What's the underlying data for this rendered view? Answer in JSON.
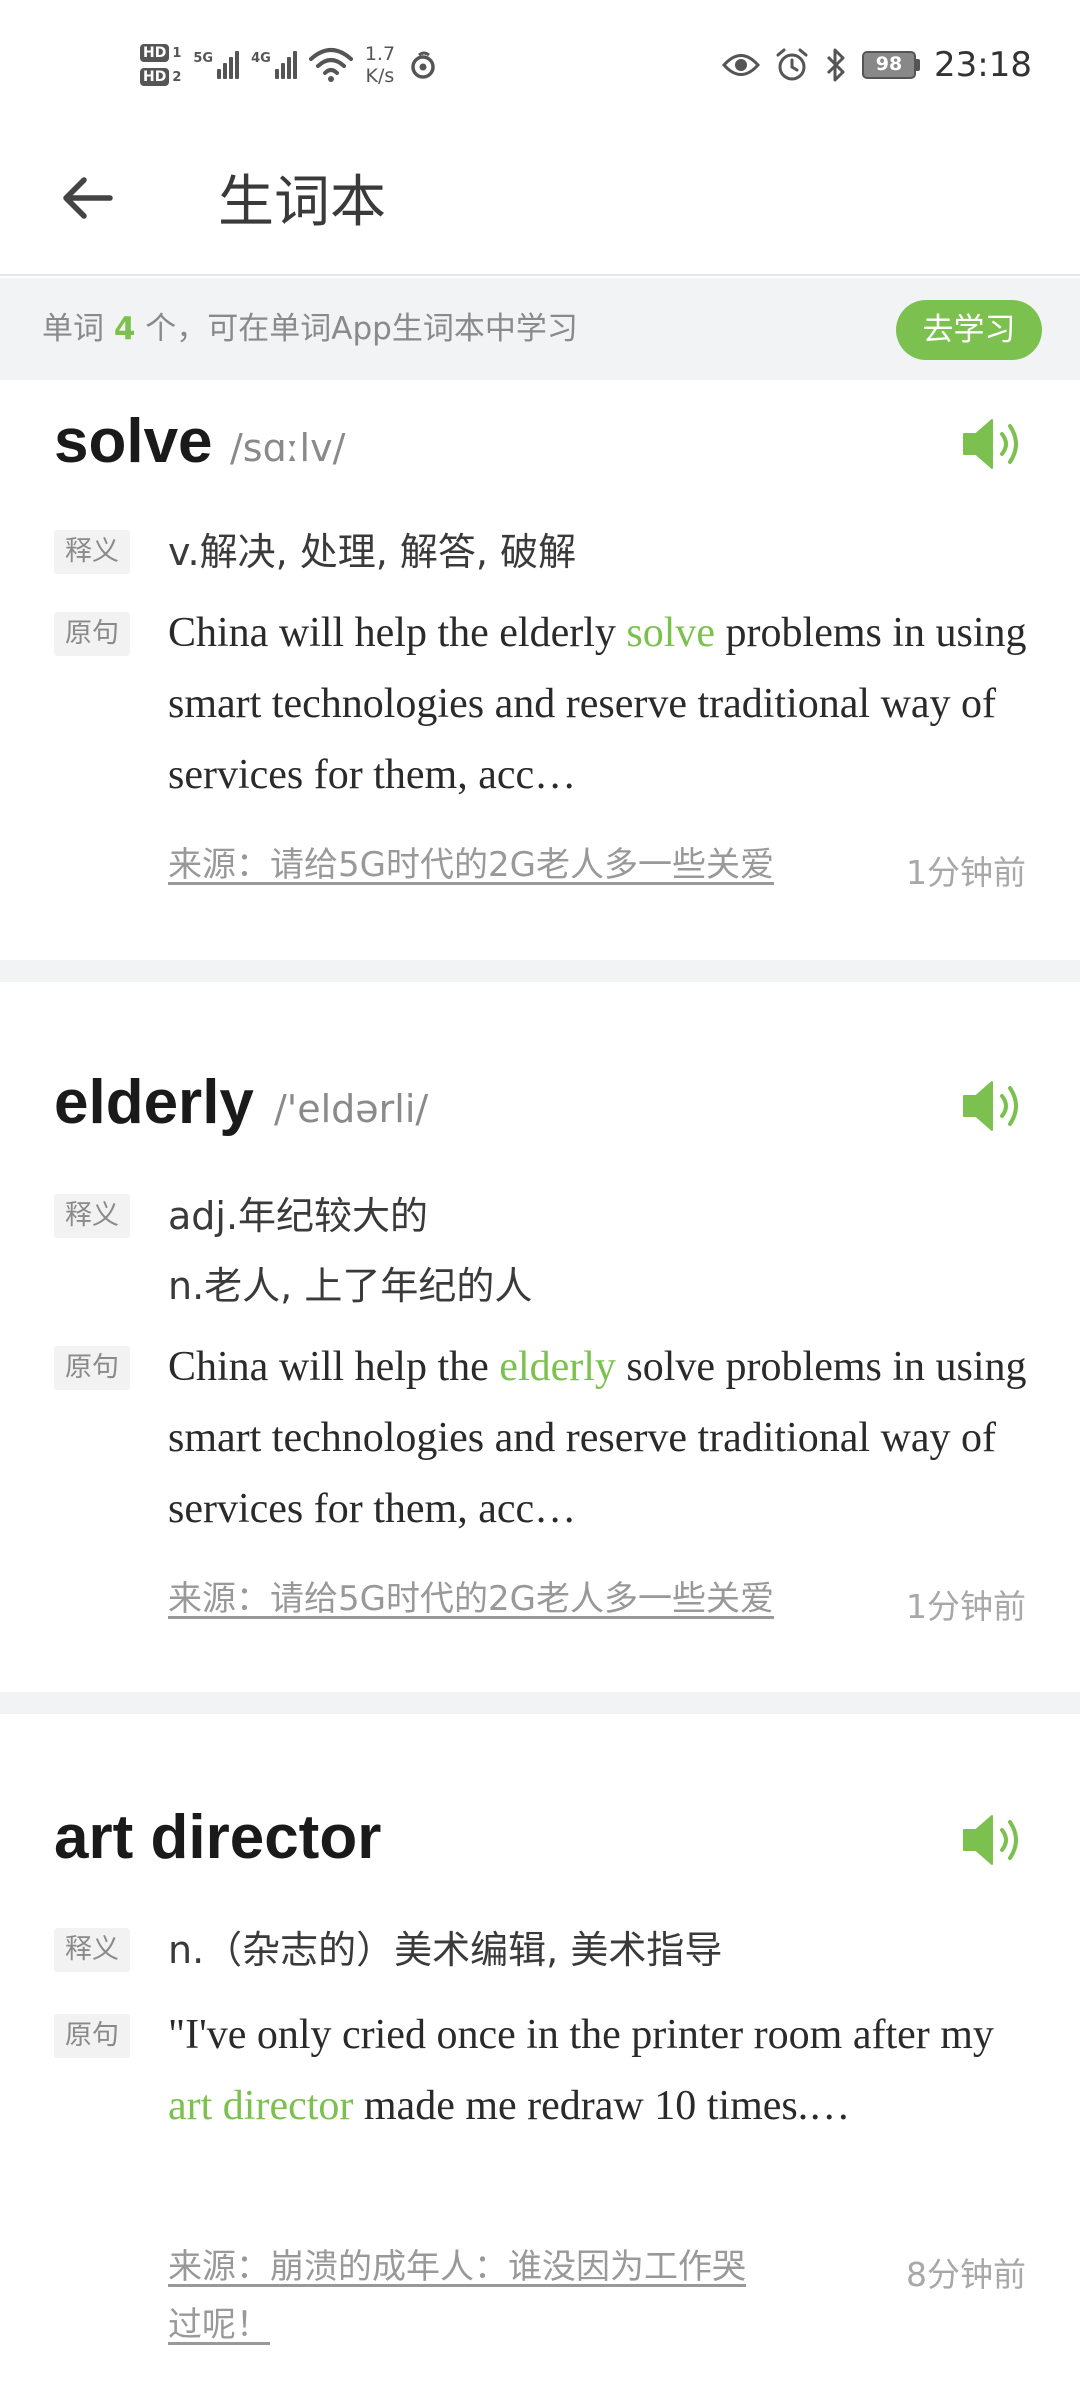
{
  "status_bar": {
    "hd1": "HD",
    "hd1_num": "1",
    "hd2": "HD",
    "hd2_num": "2",
    "sig1_label": "5G",
    "sig2_label": "4G",
    "speed_value": "1.7",
    "speed_unit": "K/s",
    "battery": "98",
    "time": "23:18",
    "icons": [
      "wifi-icon",
      "app-notification-icon",
      "eye-icon",
      "alarm-icon",
      "bluetooth-icon"
    ]
  },
  "app_bar": {
    "back_icon": "arrow-left-icon",
    "title": "生词本"
  },
  "info_strip": {
    "prefix": "单词 ",
    "count": "4",
    "suffix": " 个，可在单词App生词本中学习",
    "button_label": "去学习"
  },
  "colors": {
    "accent": "#7cc14f",
    "strip_bg": "#f2f3f5"
  },
  "words": [
    {
      "word": "solve",
      "phonetic": "/sɑːlv/",
      "tag_meaning": "释义",
      "meanings": [
        "v.解决, 处理, 解答, 破解"
      ],
      "tag_sentence": "原句",
      "sentence_before": "China will help the elderly ",
      "sentence_highlight": "solve",
      "sentence_after": " problems in using smart technologies and reserve traditional way of services for them, acc…",
      "source": "来源：请给5G时代的2G老人多一些关爱",
      "time": "1分钟前"
    },
    {
      "word": "elderly",
      "phonetic": "/'eldərli/",
      "tag_meaning": "释义",
      "meanings": [
        "adj.年纪较大的",
        "n.老人, 上了年纪的人"
      ],
      "tag_sentence": "原句",
      "sentence_before": "China will help the ",
      "sentence_highlight": "elderly",
      "sentence_after": " solve problems in using smart technologies and reserve traditional way of services for them, acc…",
      "source": "来源：请给5G时代的2G老人多一些关爱",
      "time": "1分钟前"
    },
    {
      "word": "art director",
      "phonetic": "",
      "tag_meaning": "释义",
      "meanings": [
        "n.（杂志的）美术编辑, 美术指导"
      ],
      "tag_sentence": "原句",
      "sentence_before": "\"I've only cried once in the printer room after my ",
      "sentence_highlight": "art director",
      "sentence_after": " made me redraw 10 times.…",
      "source_line1": "来源：崩溃的成年人：谁没因为工作哭",
      "source_line2": "过呢！",
      "time": "8分钟前"
    }
  ]
}
